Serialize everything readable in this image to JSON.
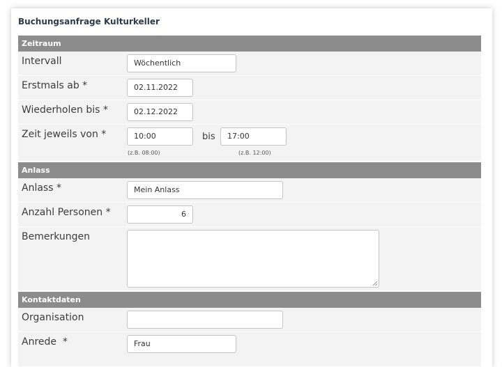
{
  "form": {
    "title": "Buchungsanfrage Kulturkeller"
  },
  "sections": {
    "zeitraum": "Zeitraum",
    "anlass": "Anlass",
    "kontakt": "Kontaktdaten"
  },
  "fields": {
    "intervall": {
      "label": "Intervall",
      "value": "Wöchentlich"
    },
    "erstmals": {
      "label": "Erstmals ab *",
      "value": "02.11.2022"
    },
    "wiederholen": {
      "label": "Wiederholen bis *",
      "value": "02.12.2022"
    },
    "zeit": {
      "label": "Zeit jeweils von *",
      "from_value": "10:00",
      "separator": "bis",
      "to_value": "17:00",
      "from_hint": "(z.B. 08:00)",
      "to_hint": "(z.B. 12:00)"
    },
    "anlass": {
      "label": "Anlass *",
      "value": "Mein Anlass"
    },
    "personen": {
      "label": "Anzahl Personen *",
      "value": "6"
    },
    "bemerkungen": {
      "label": "Bemerkungen",
      "value": ""
    },
    "organisation": {
      "label": "Organisation",
      "value": ""
    },
    "anrede": {
      "label": "Anrede  *",
      "value": "Frau"
    }
  }
}
